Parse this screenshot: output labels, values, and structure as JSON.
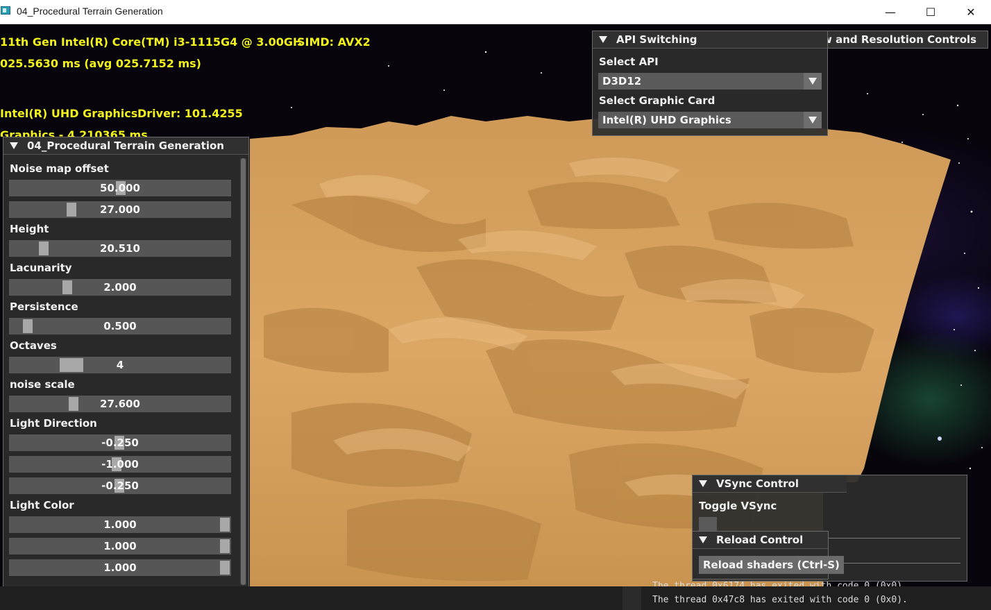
{
  "window": {
    "title": "04_Procedural Terrain Generation",
    "minimize_glyph": "—",
    "maximize_glyph": "☐",
    "close_glyph": "✕"
  },
  "overlay": {
    "cpu": "11th Gen Intel(R) Core(TM) i3-1115G4 @ 3.00GH",
    "simd": "SIMD: AVX2",
    "frame_time": "025.5630 ms (avg 025.7152 ms)",
    "gpu": "Intel(R) UHD Graphics",
    "driver": "Driver: 101.4255",
    "graphics_time": "Graphics - 4.210365 ms",
    "text_color": "#f2f21c"
  },
  "terrain_panel": {
    "title": "04_Procedural Terrain Generation",
    "noise_offset_label": "Noise map offset",
    "noise_offset_x": "50.000",
    "noise_offset_y": "27.000",
    "height_label": "Height",
    "height": "20.510",
    "lacunarity_label": "Lacunarity",
    "lacunarity": "2.000",
    "persistence_label": "Persistence",
    "persistence": "0.500",
    "octaves_label": "Octaves",
    "octaves": "4",
    "noise_scale_label": "noise scale",
    "noise_scale": "27.600",
    "light_direction_label": "Light Direction",
    "light_dir_x": "-0.250",
    "light_dir_y": "-1.000",
    "light_dir_z": "-0.250",
    "light_color_label": "Light Color",
    "light_color_r": "1.000",
    "light_color_g": "1.000",
    "light_color_b": "1.000"
  },
  "api_panel": {
    "title": "API Switching",
    "select_api_label": "Select API",
    "api_value": "D3D12",
    "select_card_label": "Select Graphic Card",
    "card_value": "Intel(R) UHD Graphics"
  },
  "resolution_panel": {
    "title_fragment": "w and Resolution Controls"
  },
  "vsync_panel": {
    "title": "VSync Control",
    "toggle_label": "Toggle VSync"
  },
  "reload_panel": {
    "title": "Reload Control",
    "button_label": "Reload shaders (Ctrl-S)"
  },
  "console": {
    "line1": "The thread 0x6174 has exited with code 0 (0x0).",
    "line2": "The thread 0x47c8 has exited with code 0 (0x0)."
  },
  "colors": {
    "panel_bg": "#2c2c2c",
    "slider_bg": "#565656",
    "grab": "#a8a8a8",
    "sand": "#d9a35f"
  }
}
